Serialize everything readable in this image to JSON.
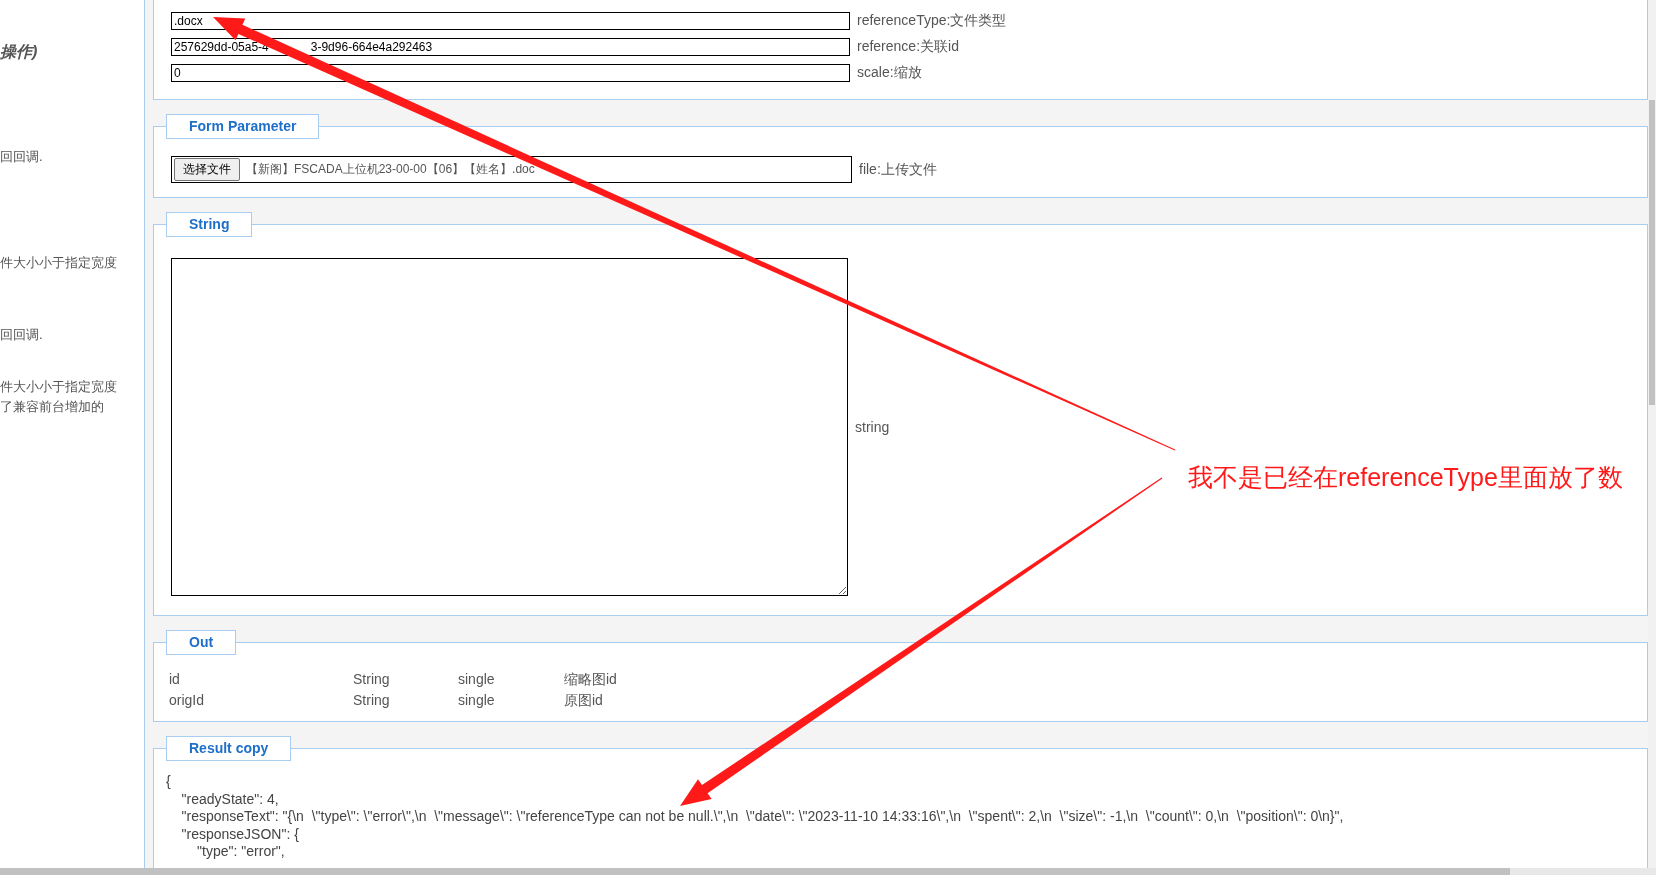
{
  "sidebar": {
    "items": [
      {
        "kind": "heading",
        "text": "操作)"
      },
      {
        "kind": "text",
        "text": "回回调."
      },
      {
        "kind": "text",
        "text": "件大小小于指定宽度"
      },
      {
        "kind": "text",
        "text": "回回调."
      },
      {
        "kind": "text",
        "text": "件大小小于指定宽度"
      },
      {
        "kind": "text",
        "text": "了兼容前台增加的"
      }
    ]
  },
  "sections": [
    {
      "kind": "params",
      "fields": [
        {
          "value_parts": [
            ".docx"
          ],
          "label": "referenceType:文件类型"
        },
        {
          "value_parts": [
            "257629dd-05a5-4",
            "3-9d96-664e4a292463"
          ],
          "label": "reference:关联id"
        },
        {
          "value_parts": [
            "0"
          ],
          "label": "scale:缩放"
        }
      ]
    },
    {
      "kind": "file",
      "legend": "Form Parameter",
      "button": "选择文件",
      "file_name": "【新阁】FSCADA上位机23-00-00【06】【姓名】.doc",
      "label": "file:上传文件"
    },
    {
      "kind": "textarea",
      "legend": "String",
      "label": "string"
    },
    {
      "kind": "table",
      "legend": "Out",
      "rows": [
        [
          "id",
          "String",
          "single",
          "缩略图id"
        ],
        [
          "origId",
          "String",
          "single",
          "原图id"
        ]
      ]
    },
    {
      "kind": "code",
      "legend": "Result copy",
      "lines": [
        "{",
        "    \"readyState\": 4,",
        "    \"responseText\": \"{\\n  \\\"type\\\": \\\"error\\\",\\n  \\\"message\\\": \\\"referenceType can not be null.\\\",\\n  \\\"date\\\": \\\"2023-11-10 14:33:16\\\",\\n  \\\"spent\\\": 2,\\n  \\\"size\\\": -1,\\n  \\\"count\\\": 0,\\n  \\\"position\\\": 0\\n}\",",
        "    \"responseJSON\": {",
        "        \"type\": \"error\","
      ]
    }
  ],
  "annotation": {
    "text": "我不是已经在referenceType里面放了数"
  }
}
